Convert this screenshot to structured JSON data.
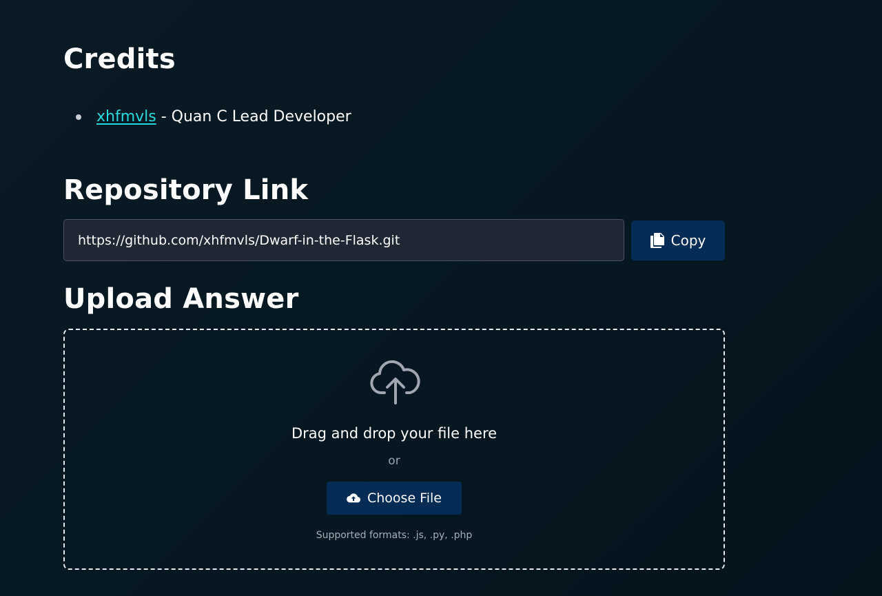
{
  "credits": {
    "title": "Credits",
    "items": [
      {
        "link_text": "xhfmvls",
        "description": " - Quan C Lead Developer"
      }
    ]
  },
  "repository": {
    "title": "Repository Link",
    "url": "https://github.com/xhfmvls/Dwarf-in-the-Flask.git",
    "copy_label": "Copy",
    "copy_icon": "copy-icon"
  },
  "upload": {
    "title": "Upload Answer",
    "icon": "cloud-upload-icon",
    "drop_text": "Drag and drop your file here",
    "or_text": "or",
    "choose_label": "Choose File",
    "choose_icon": "cloud-upload-icon",
    "formats_text": "Supported formats: .js, .py, .php"
  },
  "colors": {
    "background": "#061822",
    "link": "#2ad9dc",
    "button": "#052c55",
    "input_bg": "#1f2735"
  }
}
